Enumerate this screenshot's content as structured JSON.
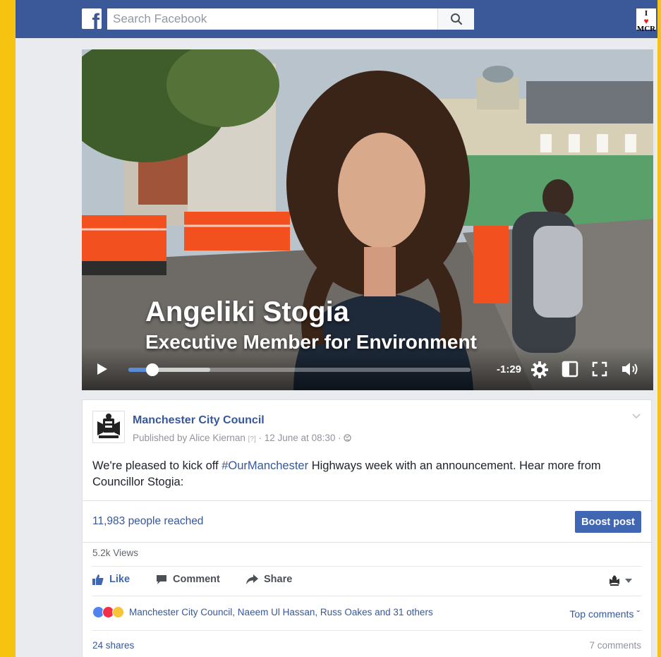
{
  "topbar": {
    "logo": "f",
    "search_placeholder": "Search Facebook",
    "search_icon": "search-icon",
    "avatar_line1": "I",
    "avatar_heart": "♥",
    "avatar_line2": "MCR"
  },
  "video": {
    "caption_name": "Angeliki Stogia",
    "caption_role": "Executive Member for Environment",
    "time_remaining": "-1:29",
    "progress_fraction": 0.07,
    "buffered_fraction": 0.24,
    "icons": [
      "play-icon",
      "settings-icon",
      "pip-icon",
      "fullscreen-icon",
      "volume-icon"
    ]
  },
  "post": {
    "page_name": "Manchester City Council",
    "byline_prefix": "Published by Alice Kiernan",
    "byline_q": "[?]",
    "byline_date": "· 12 June at 08:30 ·",
    "text_before": "We're pleased to kick off ",
    "hashtag": "#OurManchester",
    "text_after": " Highways week with an announcement. Hear more from Councillor Stogia:",
    "reach": "11,983 people reached",
    "boost_label": "Boost post",
    "views": "5.2k Views",
    "like_label": "Like",
    "comment_label": "Comment",
    "share_label": "Share",
    "reactions_names": "Manchester City Council, Naeem Ul Hassan, Russ Oakes and 31 others",
    "top_comments": "Top comments ˇ",
    "shares": "24 shares",
    "comments": "7 comments"
  },
  "colors": {
    "brand": "#3b5998",
    "link": "#365899",
    "boost": "#4267b2",
    "frame": "#f6c410"
  }
}
